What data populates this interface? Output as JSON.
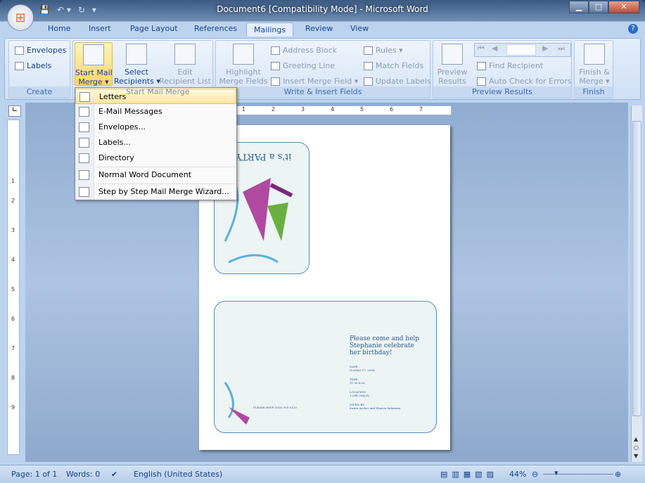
{
  "window": {
    "title": "Document6 [Compatibility Mode] - Microsoft Word"
  },
  "tabs": [
    "Home",
    "Insert",
    "Page Layout",
    "References",
    "Mailings",
    "Review",
    "View"
  ],
  "ribbon": {
    "create": {
      "label": "Create",
      "envelopes": "Envelopes",
      "labels": "Labels"
    },
    "start": {
      "label": "Start Mail Merge",
      "start_merge": "Start Mail",
      "start_merge2": "Merge",
      "select": "Select",
      "select2": "Recipients",
      "edit": "Edit",
      "edit2": "Recipient List"
    },
    "write": {
      "label": "Write & Insert Fields",
      "highlight": "Highlight",
      "highlight2": "Merge Fields",
      "address": "Address Block",
      "greeting": "Greeting Line",
      "insert_field": "Insert Merge Field",
      "rules": "Rules",
      "match": "Match Fields",
      "update": "Update Labels"
    },
    "preview": {
      "label": "Preview Results",
      "preview": "Preview",
      "preview2": "Results",
      "find": "Find Recipient",
      "auto_check": "Auto Check for Errors"
    },
    "finish": {
      "label": "Finish",
      "finish": "Finish &",
      "finish2": "Merge"
    }
  },
  "menu": {
    "items": [
      "Letters",
      "E-Mail Messages",
      "Envelopes...",
      "Labels...",
      "Directory",
      "Normal Word Document",
      "Step by Step Mail Merge Wizard..."
    ]
  },
  "ruler": [
    "1",
    "2",
    "3",
    "4",
    "5",
    "6",
    "7"
  ],
  "vruler": [
    "1",
    "2",
    "3",
    "4",
    "5",
    "6",
    "7",
    "8",
    "9"
  ],
  "card": {
    "front": "it's a PARTY!",
    "invite": "Please come and help Stephanie celebrate her birthday!",
    "date_label": "DATE:",
    "date": "October 17, 2006",
    "time_label": "TIME:",
    "time": "11:00 A.M.",
    "loc_label": "LOCATION:",
    "loc": "12345 Oak St.",
    "given_label": "GIVEN BY:",
    "given": "Karen Archer and Sharon Salavaria",
    "rsvp": "PLEASE RSVP (555) 555-0125"
  },
  "status": {
    "page": "Page: 1 of 1",
    "words": "Words: 0",
    "language": "English (United States)",
    "zoom": "44%"
  }
}
